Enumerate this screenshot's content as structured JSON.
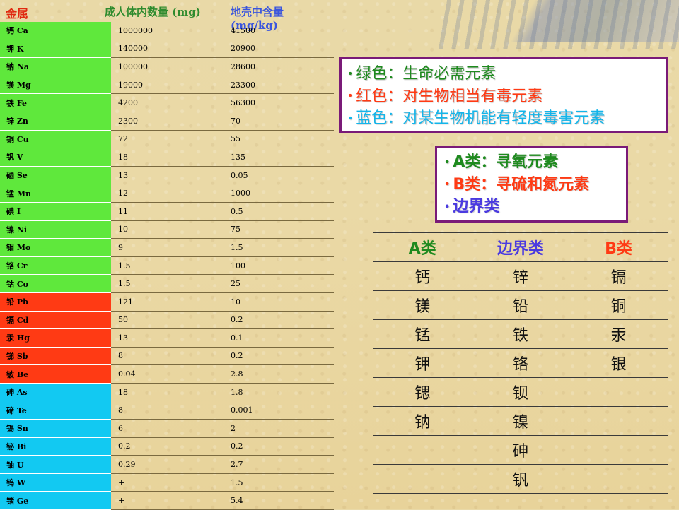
{
  "table": {
    "headers": {
      "metal": "金属",
      "body": "成人体内数量 (mg)",
      "crust": "地壳中含量 (mg/kg)"
    },
    "rows": [
      {
        "name": "钙 Ca",
        "body": "1000000",
        "crust": "41500",
        "group": "essential"
      },
      {
        "name": "钾 K",
        "body": "140000",
        "crust": "20900",
        "group": "essential"
      },
      {
        "name": "钠 Na",
        "body": "100000",
        "crust": "28600",
        "group": "essential"
      },
      {
        "name": "镁 Mg",
        "body": "19000",
        "crust": "23300",
        "group": "essential"
      },
      {
        "name": "铁 Fe",
        "body": "4200",
        "crust": "56300",
        "group": "essential"
      },
      {
        "name": "锌 Zn",
        "body": "2300",
        "crust": "70",
        "group": "essential"
      },
      {
        "name": "铜 Cu",
        "body": "72",
        "crust": "55",
        "group": "essential"
      },
      {
        "name": "钒 V",
        "body": "18",
        "crust": "135",
        "group": "essential"
      },
      {
        "name": "硒 Se",
        "body": "13",
        "crust": "0.05",
        "group": "essential"
      },
      {
        "name": "锰 Mn",
        "body": "12",
        "crust": "1000",
        "group": "essential"
      },
      {
        "name": "碘 I",
        "body": "11",
        "crust": "0.5",
        "group": "essential"
      },
      {
        "name": "镍 Ni",
        "body": "10",
        "crust": "75",
        "group": "essential"
      },
      {
        "name": "钼 Mo",
        "body": "9",
        "crust": "1.5",
        "group": "essential"
      },
      {
        "name": "铬 Cr",
        "body": "1.5",
        "crust": "100",
        "group": "essential"
      },
      {
        "name": "钴 Co",
        "body": "1.5",
        "crust": "25",
        "group": "essential"
      },
      {
        "name": "铅 Pb",
        "body": "121",
        "crust": "10",
        "group": "toxic"
      },
      {
        "name": "镉 Cd",
        "body": "50",
        "crust": "0.2",
        "group": "toxic"
      },
      {
        "name": "汞 Hg",
        "body": "13",
        "crust": "0.1",
        "group": "toxic"
      },
      {
        "name": "锑 Sb",
        "body": "8",
        "crust": "0.2",
        "group": "toxic"
      },
      {
        "name": "铍 Be",
        "body": "0.04",
        "crust": "2.8",
        "group": "toxic"
      },
      {
        "name": "砷 As",
        "body": "18",
        "crust": "1.8",
        "group": "mild"
      },
      {
        "name": "碲 Te",
        "body": "8",
        "crust": "0.001",
        "group": "mild"
      },
      {
        "name": "锡 Sn",
        "body": "6",
        "crust": "2",
        "group": "mild"
      },
      {
        "name": "铋 Bi",
        "body": "0.2",
        "crust": "0.2",
        "group": "mild"
      },
      {
        "name": "铀 U",
        "body": "0.29",
        "crust": "2.7",
        "group": "mild"
      },
      {
        "name": "钨 W",
        "body": "+",
        "crust": "1.5",
        "group": "mild"
      },
      {
        "name": "锗 Ge",
        "body": "+",
        "crust": "5.4",
        "group": "mild"
      }
    ]
  },
  "legend": {
    "items": [
      {
        "text": "绿色：生命必需元素",
        "color": "#1e8a1e"
      },
      {
        "text": "红色：对生物相当有毒元素",
        "color": "#ff3a14"
      },
      {
        "text": "蓝色：对某生物机能有轻度毒害元素",
        "color": "#13b5ea"
      }
    ],
    "bullet": "•"
  },
  "classes": {
    "items": [
      {
        "text": "A类：寻氧元素",
        "color": "#1e8a1e"
      },
      {
        "text": "B类：寻硫和氮元素",
        "color": "#ff3a14"
      },
      {
        "text": "边界类",
        "color": "#4a3ae0"
      }
    ]
  },
  "class_table": {
    "headers": [
      "A类",
      "边界类",
      "B类"
    ],
    "rows": [
      [
        "钙",
        "锌",
        "镉"
      ],
      [
        "镁",
        "铅",
        "铜"
      ],
      [
        "锰",
        "铁",
        "汞"
      ],
      [
        "钾",
        "铬",
        "银"
      ],
      [
        "锶",
        "钡",
        ""
      ],
      [
        "钠",
        "镍",
        ""
      ],
      [
        "",
        "砷",
        ""
      ],
      [
        "",
        "钒",
        ""
      ]
    ]
  },
  "colors": {
    "essential": "#5fe83c",
    "toxic": "#ff3a14",
    "mild": "#12c9f2",
    "border": "#7a1a78"
  }
}
